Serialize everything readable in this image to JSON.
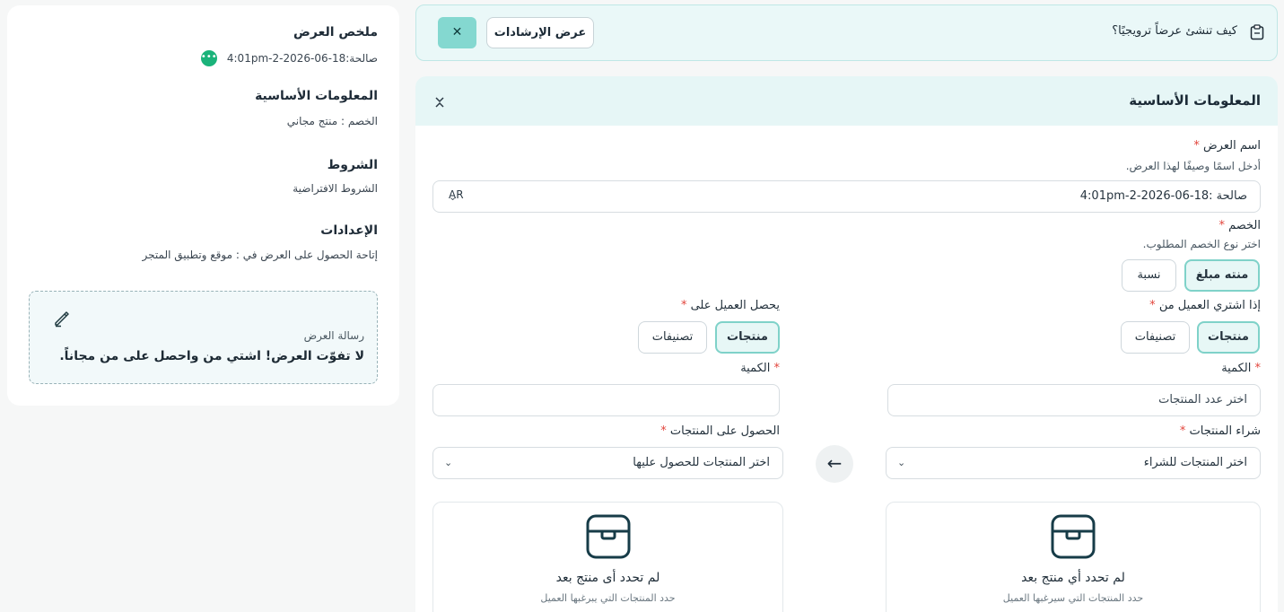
{
  "summary": {
    "title": "ملخص العرض",
    "validity": "صالحة:18-06-2026-2-4:01pm",
    "more_icon": "ellipsis-icon",
    "basic_info": {
      "title": "المعلومات الأساسية",
      "discount_line": "الخصم :  منتج مجاني"
    },
    "conditions": {
      "title": "الشروط",
      "text": "الشروط الافتراضية"
    },
    "settings": {
      "title": "الإعدادات",
      "text": "إتاحة الحصول على العرض في :  موقع وتطبيق المتجر"
    },
    "message": {
      "label": "رسالة العرض",
      "text": "لا تفوّت العرض! اشتي من واحصل على من مجاناً.",
      "edit_icon": "pencil-icon"
    }
  },
  "banner": {
    "question": "كيف تنشئ عرضاً ترويجيًا؟",
    "guide_button": "عرض الإرشادات",
    "close_icon": "close-icon",
    "info_icon": "clipboard-icon"
  },
  "form": {
    "section_title": "المعلومات الأساسية",
    "collapse_icon": "collapse-chevrons-icon",
    "offer_name": {
      "label": "اسم العرض",
      "required_mark": "*",
      "hint": "أدخل اسمًا وصيفًا لهذا العرض.",
      "value": "صالحة :18-06-2026-2-4:01pm",
      "language": "AR"
    },
    "discount": {
      "label": "الخصم",
      "required_mark": "*",
      "hint": "اختر نوع الخصم المطلوب.",
      "options": [
        "منته مبلغ",
        "نسبة"
      ]
    },
    "buy": {
      "label": "إذا اشتري العميل من",
      "required_mark": "*",
      "options": [
        "منتجات",
        "تصنيفات"
      ],
      "quantity_label": "الكمية",
      "quantity_placeholder": "اختر عدد المنتجات",
      "products_label": "شراء المنتجات",
      "products_placeholder": "اختر المنتجات للشراء",
      "empty_title": "لم تحدد أي منتج بعد",
      "empty_sub": "حدد المنتجات التي سيرغبها العميل"
    },
    "get": {
      "label": "يحصل العميل على",
      "required_mark": "*",
      "options": [
        "منتجات",
        "تصنيفات"
      ],
      "quantity_label": "الكمية",
      "quantity_placeholder": "",
      "products_label": "الحصول على المنتجات",
      "products_placeholder": "اختر المنتجات للحصول عليها",
      "empty_title": "لم تحدد أى منتج بعد",
      "empty_sub": "حدد المنتجات التي يبرغبها العميل"
    },
    "arrow_icon": "arrow-left-icon"
  },
  "colors": {
    "accent": "#84d8d0",
    "banner_bg": "#eaf8f8",
    "required": "#e2453c",
    "status_green": "#1bb37a"
  }
}
